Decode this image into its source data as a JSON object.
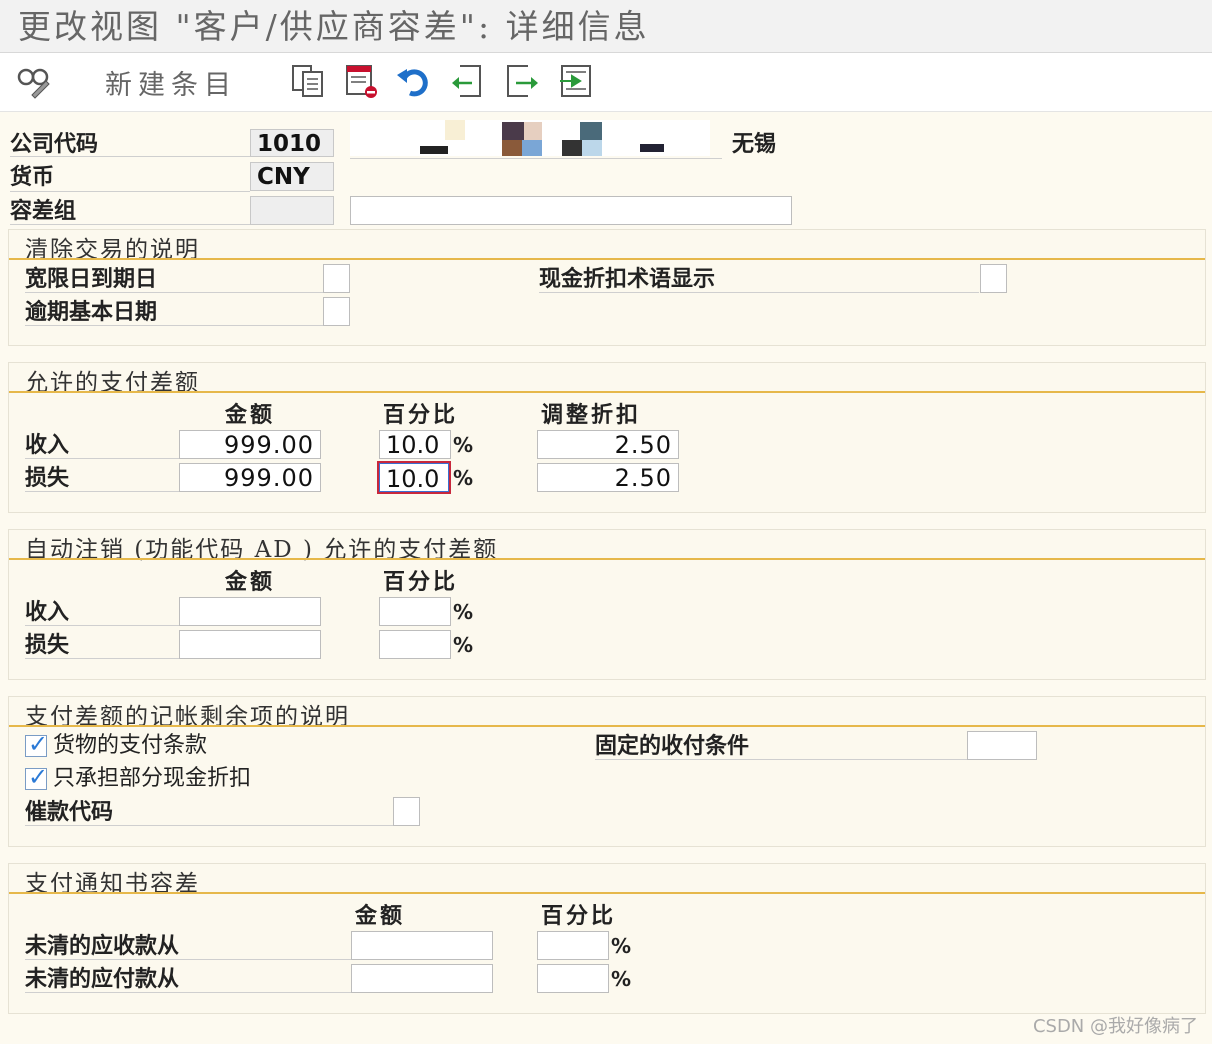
{
  "window": {
    "title": "更改视图 \"客户/供应商容差\": 详细信息"
  },
  "toolbar": {
    "new_entry_label": "新建条目",
    "icons": [
      "glasses-pencil-icon",
      "copy-icon",
      "delete-icon",
      "undo-icon",
      "previous-entry-icon",
      "next-entry-icon",
      "select-all-icon"
    ]
  },
  "header": {
    "company_code_label": "公司代码",
    "company_code_value": "1010",
    "company_name_suffix": "无锡",
    "currency_label": "货币",
    "currency_value": "CNY",
    "tolerance_group_label": "容差组",
    "tolerance_group_value": "",
    "tolerance_group_desc": ""
  },
  "clearing": {
    "title": "清除交易的说明",
    "grace_days_label": "宽限日到期日",
    "grace_days_value": "",
    "cash_discount_label": "现金折扣术语显示",
    "cash_discount_value": "",
    "arrears_base_label": "逾期基本日期",
    "arrears_base_value": ""
  },
  "permitted": {
    "title": "允许的支付差额",
    "col_amount": "金额",
    "col_percent": "百分比",
    "col_adjust": "调整折扣",
    "gain_label": "收入",
    "loss_label": "损失",
    "gain_amount": "999.00",
    "gain_percent": "10.0",
    "gain_adjust": "2.50",
    "loss_amount": "999.00",
    "loss_percent": "10.0",
    "loss_adjust": "2.50",
    "percent_sign": "%"
  },
  "auto_writeoff": {
    "title": "自动注销 (功能代码 AD ) 允许的支付差额",
    "col_amount": "金额",
    "col_percent": "百分比",
    "gain_label": "收入",
    "loss_label": "损失",
    "gain_amount": "",
    "gain_percent": "",
    "loss_amount": "",
    "loss_percent": "",
    "percent_sign": "%"
  },
  "posting": {
    "title": "支付差额的记帐剩余项的说明",
    "terms_label": "货物的支付条款",
    "terms_checked": true,
    "partial_discount_label": "只承担部分现金折扣",
    "partial_discount_checked": true,
    "dunning_key_label": "催款代码",
    "dunning_key_value": "",
    "fixed_terms_label": "固定的收付条件",
    "fixed_terms_value": ""
  },
  "advice": {
    "title": "支付通知书容差",
    "col_amount": "金额",
    "col_percent": "百分比",
    "receivable_label": "未清的应收款从",
    "payable_label": "未清的应付款从",
    "receivable_amount": "",
    "receivable_percent": "",
    "payable_amount": "",
    "payable_percent": "",
    "percent_sign": "%"
  },
  "watermark": "CSDN @我好像病了"
}
